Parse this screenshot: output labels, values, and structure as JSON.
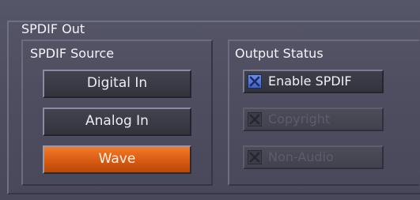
{
  "panel": {
    "title": "SPDIF Out"
  },
  "source": {
    "title": "SPDIF Source",
    "options": [
      {
        "label": "Digital In",
        "selected": false
      },
      {
        "label": "Analog In",
        "selected": false
      },
      {
        "label": "Wave",
        "selected": true
      }
    ]
  },
  "status": {
    "title": "Output Status",
    "options": [
      {
        "label": "Enable SPDIF",
        "checked": true,
        "enabled": true
      },
      {
        "label": "Copyright",
        "checked": true,
        "enabled": false
      },
      {
        "label": "Non-Audio",
        "checked": true,
        "enabled": false
      }
    ]
  },
  "colors": {
    "accent": "#e0661a",
    "checkbox_blue": "#4a6fd8",
    "panel": "#505064"
  },
  "icons": [
    "check-mark-icon"
  ]
}
